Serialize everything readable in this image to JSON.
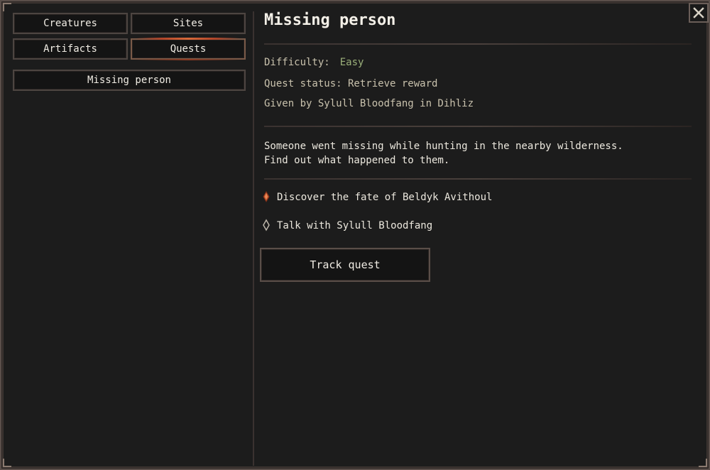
{
  "tabs": {
    "creatures": "Creatures",
    "sites": "Sites",
    "artifacts": "Artifacts",
    "quests": "Quests",
    "active": "quests"
  },
  "quest_list": [
    "Missing person"
  ],
  "quest": {
    "title": "Missing person",
    "difficulty_label": "Difficulty:",
    "difficulty_value": "Easy",
    "status": "Quest status: Retrieve reward",
    "given_by": "Given by Sylull Bloodfang in Dihliz",
    "description_line1": "Someone went missing while hunting in the nearby wilderness.",
    "description_line2": "Find out what happened to them.",
    "objectives": [
      {
        "text": "Discover the fate of Beldyk Avithoul",
        "icon": "objective-complete-icon"
      },
      {
        "text": "Talk with Sylull Bloodfang",
        "icon": "objective-pending-icon"
      }
    ],
    "track_button": "Track quest"
  },
  "colors": {
    "accent_active": "#d96a3a",
    "difficulty_easy": "#9bb07a",
    "meta_text": "#c9c2ad"
  }
}
